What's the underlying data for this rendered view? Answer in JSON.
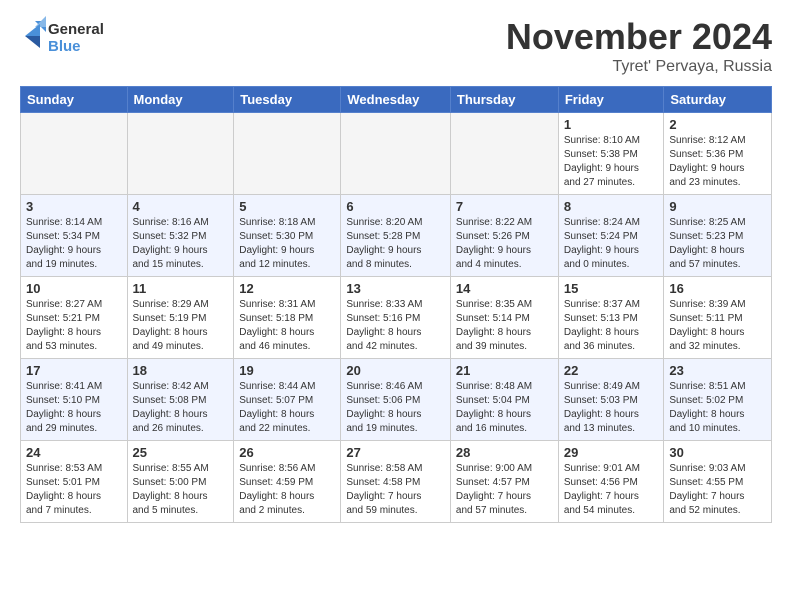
{
  "header": {
    "logo_general": "General",
    "logo_blue": "Blue",
    "month": "November 2024",
    "location": "Tyret' Pervaya, Russia"
  },
  "days_of_week": [
    "Sunday",
    "Monday",
    "Tuesday",
    "Wednesday",
    "Thursday",
    "Friday",
    "Saturday"
  ],
  "weeks": [
    [
      {
        "day": "",
        "info": ""
      },
      {
        "day": "",
        "info": ""
      },
      {
        "day": "",
        "info": ""
      },
      {
        "day": "",
        "info": ""
      },
      {
        "day": "",
        "info": ""
      },
      {
        "day": "1",
        "info": "Sunrise: 8:10 AM\nSunset: 5:38 PM\nDaylight: 9 hours\nand 27 minutes."
      },
      {
        "day": "2",
        "info": "Sunrise: 8:12 AM\nSunset: 5:36 PM\nDaylight: 9 hours\nand 23 minutes."
      }
    ],
    [
      {
        "day": "3",
        "info": "Sunrise: 8:14 AM\nSunset: 5:34 PM\nDaylight: 9 hours\nand 19 minutes."
      },
      {
        "day": "4",
        "info": "Sunrise: 8:16 AM\nSunset: 5:32 PM\nDaylight: 9 hours\nand 15 minutes."
      },
      {
        "day": "5",
        "info": "Sunrise: 8:18 AM\nSunset: 5:30 PM\nDaylight: 9 hours\nand 12 minutes."
      },
      {
        "day": "6",
        "info": "Sunrise: 8:20 AM\nSunset: 5:28 PM\nDaylight: 9 hours\nand 8 minutes."
      },
      {
        "day": "7",
        "info": "Sunrise: 8:22 AM\nSunset: 5:26 PM\nDaylight: 9 hours\nand 4 minutes."
      },
      {
        "day": "8",
        "info": "Sunrise: 8:24 AM\nSunset: 5:24 PM\nDaylight: 9 hours\nand 0 minutes."
      },
      {
        "day": "9",
        "info": "Sunrise: 8:25 AM\nSunset: 5:23 PM\nDaylight: 8 hours\nand 57 minutes."
      }
    ],
    [
      {
        "day": "10",
        "info": "Sunrise: 8:27 AM\nSunset: 5:21 PM\nDaylight: 8 hours\nand 53 minutes."
      },
      {
        "day": "11",
        "info": "Sunrise: 8:29 AM\nSunset: 5:19 PM\nDaylight: 8 hours\nand 49 minutes."
      },
      {
        "day": "12",
        "info": "Sunrise: 8:31 AM\nSunset: 5:18 PM\nDaylight: 8 hours\nand 46 minutes."
      },
      {
        "day": "13",
        "info": "Sunrise: 8:33 AM\nSunset: 5:16 PM\nDaylight: 8 hours\nand 42 minutes."
      },
      {
        "day": "14",
        "info": "Sunrise: 8:35 AM\nSunset: 5:14 PM\nDaylight: 8 hours\nand 39 minutes."
      },
      {
        "day": "15",
        "info": "Sunrise: 8:37 AM\nSunset: 5:13 PM\nDaylight: 8 hours\nand 36 minutes."
      },
      {
        "day": "16",
        "info": "Sunrise: 8:39 AM\nSunset: 5:11 PM\nDaylight: 8 hours\nand 32 minutes."
      }
    ],
    [
      {
        "day": "17",
        "info": "Sunrise: 8:41 AM\nSunset: 5:10 PM\nDaylight: 8 hours\nand 29 minutes."
      },
      {
        "day": "18",
        "info": "Sunrise: 8:42 AM\nSunset: 5:08 PM\nDaylight: 8 hours\nand 26 minutes."
      },
      {
        "day": "19",
        "info": "Sunrise: 8:44 AM\nSunset: 5:07 PM\nDaylight: 8 hours\nand 22 minutes."
      },
      {
        "day": "20",
        "info": "Sunrise: 8:46 AM\nSunset: 5:06 PM\nDaylight: 8 hours\nand 19 minutes."
      },
      {
        "day": "21",
        "info": "Sunrise: 8:48 AM\nSunset: 5:04 PM\nDaylight: 8 hours\nand 16 minutes."
      },
      {
        "day": "22",
        "info": "Sunrise: 8:49 AM\nSunset: 5:03 PM\nDaylight: 8 hours\nand 13 minutes."
      },
      {
        "day": "23",
        "info": "Sunrise: 8:51 AM\nSunset: 5:02 PM\nDaylight: 8 hours\nand 10 minutes."
      }
    ],
    [
      {
        "day": "24",
        "info": "Sunrise: 8:53 AM\nSunset: 5:01 PM\nDaylight: 8 hours\nand 7 minutes."
      },
      {
        "day": "25",
        "info": "Sunrise: 8:55 AM\nSunset: 5:00 PM\nDaylight: 8 hours\nand 5 minutes."
      },
      {
        "day": "26",
        "info": "Sunrise: 8:56 AM\nSunset: 4:59 PM\nDaylight: 8 hours\nand 2 minutes."
      },
      {
        "day": "27",
        "info": "Sunrise: 8:58 AM\nSunset: 4:58 PM\nDaylight: 7 hours\nand 59 minutes."
      },
      {
        "day": "28",
        "info": "Sunrise: 9:00 AM\nSunset: 4:57 PM\nDaylight: 7 hours\nand 57 minutes."
      },
      {
        "day": "29",
        "info": "Sunrise: 9:01 AM\nSunset: 4:56 PM\nDaylight: 7 hours\nand 54 minutes."
      },
      {
        "day": "30",
        "info": "Sunrise: 9:03 AM\nSunset: 4:55 PM\nDaylight: 7 hours\nand 52 minutes."
      }
    ]
  ]
}
